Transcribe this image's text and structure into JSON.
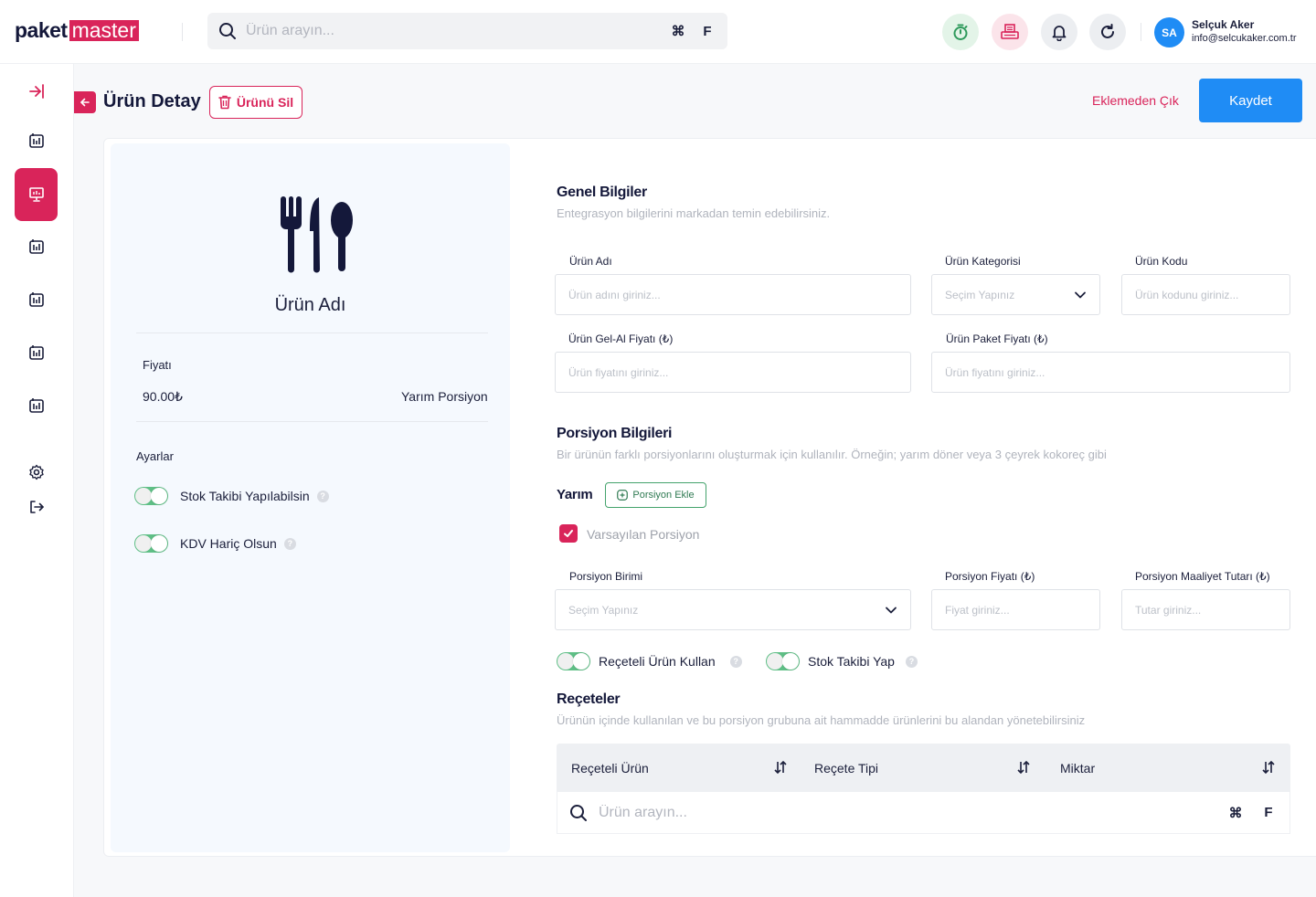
{
  "topbar": {
    "logo_part1": "paket",
    "logo_part2": "master",
    "search_placeholder": "Ürün arayın...",
    "shortcut_cmd": "⌘",
    "shortcut_key": "F",
    "icon_colors": {
      "timer": "#e3f4e8",
      "printer": "#fbe4ea",
      "bell": "#eceef1",
      "refresh": "#eceef1"
    }
  },
  "user": {
    "initials": "SA",
    "name": "Selçuk Aker",
    "email": "info@selcukaker.com.tr"
  },
  "header": {
    "title": "Ürün Detay",
    "delete_label": "Ürünü Sil",
    "exit_label": "Eklemeden Çık",
    "save_label": "Kaydet"
  },
  "product": {
    "name": "Ürün Adı",
    "price_label": "Fiyatı",
    "price_value": "90.00₺",
    "portion_value": "Yarım Porsiyon",
    "settings_label": "Ayarlar",
    "settings": [
      {
        "label": "Stok Takibi Yapılabilsin",
        "on": true
      },
      {
        "label": "KDV Hariç Olsun",
        "on": true
      }
    ]
  },
  "general": {
    "title": "Genel Bilgiler",
    "subtitle": "Entegrasyon bilgilerini markadan temin edebilirsiniz.",
    "fields": {
      "name": {
        "label": "Ürün Adı",
        "placeholder": "Ürün adını giriniz..."
      },
      "category": {
        "label": "Ürün Kategorisi",
        "placeholder": "Seçim Yapınız"
      },
      "code": {
        "label": "Ürün Kodu",
        "placeholder": "Ürün kodunu giriniz..."
      },
      "takeaway_price": {
        "label": "Ürün Gel-Al Fiyatı (₺)",
        "placeholder": "Ürün fiyatını giriniz..."
      },
      "package_price": {
        "label": "Ürün Paket Fiyatı (₺)",
        "placeholder": "Ürün fiyatını giriniz..."
      }
    }
  },
  "portion": {
    "title": "Porsiyon Bilgileri",
    "subtitle": "Bir ürünün farklı porsiyonlarını oluşturmak için kullanılır. Örneğin; yarım döner veya 3 çeyrek kokoreç gibi",
    "current": "Yarım",
    "add_label": "Porsiyon Ekle",
    "default_label": "Varsayılan Porsiyon",
    "default_checked": true,
    "fields": {
      "unit": {
        "label": "Porsiyon Birimi",
        "placeholder": "Seçim Yapınız"
      },
      "price": {
        "label": "Porsiyon Fiyatı (₺)",
        "placeholder": "Fiyat giriniz..."
      },
      "cost": {
        "label": "Porsiyon Maaliyet Tutarı (₺)",
        "placeholder": "Tutar giriniz..."
      }
    },
    "toggles": [
      {
        "label": "Reçeteli Ürün Kullan",
        "on": true
      },
      {
        "label": "Stok Takibi Yap",
        "on": true
      }
    ]
  },
  "recipes": {
    "title": "Reçeteler",
    "subtitle": "Ürünün içinde kullanılan ve bu porsiyon grubuna ait hammadde ürünlerini bu alandan yönetebilirsiniz",
    "columns": [
      "Reçeteli Ürün",
      "Reçete Tipi",
      "Miktar"
    ],
    "search_placeholder": "Ürün arayın...",
    "shortcut_cmd": "⌘",
    "shortcut_key": "F"
  },
  "colors": {
    "brand": "#d9245a",
    "primary": "#1f8cf5",
    "toggle_on": "#5fbf86",
    "panel_bg": "#f5f9fe"
  }
}
